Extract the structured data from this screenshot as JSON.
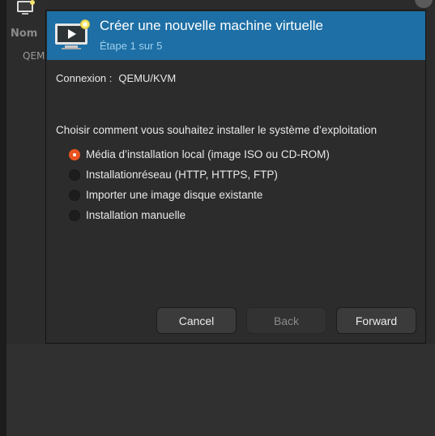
{
  "background": {
    "column_header": "Nom",
    "row_label": "QEM"
  },
  "dialog": {
    "title": "Créer une nouvelle machine virtuelle",
    "step": "Étape 1 sur 5",
    "connection_label": "Connexion :",
    "connection_value": "QEMU/KVM",
    "question": "Choisir comment vous souhaitez installer le système d’exploitation",
    "options": [
      {
        "label": "Média d’installation local (image ISO ou CD-ROM)",
        "checked": true
      },
      {
        "label": "Installationréseau (HTTP, HTTPS, FTP)",
        "checked": false
      },
      {
        "label": "Importer une image disque existante",
        "checked": false
      },
      {
        "label": "Installation manuelle",
        "checked": false
      }
    ],
    "buttons": {
      "cancel": "Cancel",
      "back": "Back",
      "forward": "Forward"
    }
  },
  "colors": {
    "banner": "#1d6fa5",
    "radio_selected": "#e95420"
  },
  "icons": {
    "banner": "new-vm-monitor-icon",
    "background_app": "app-monitor-icon"
  }
}
